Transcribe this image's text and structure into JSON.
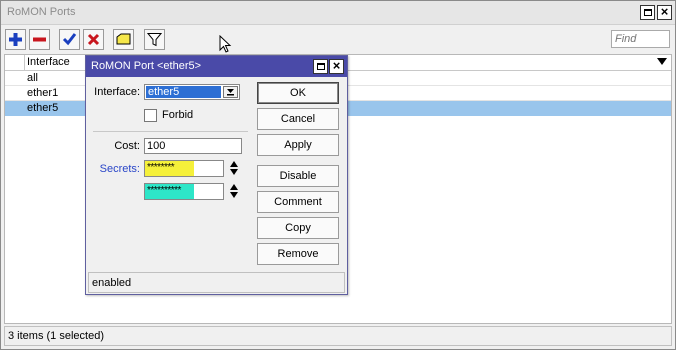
{
  "window": {
    "title": "RoMON Ports"
  },
  "toolbar": {
    "find_placeholder": "Find"
  },
  "table": {
    "column_header": "Interface",
    "rows": [
      {
        "interface": "all",
        "selected": false
      },
      {
        "interface": "ether1",
        "selected": false
      },
      {
        "interface": "ether5",
        "selected": true
      }
    ]
  },
  "status_bar": {
    "text": "3 items (1 selected)"
  },
  "dialog": {
    "title": "RoMON Port <ether5>",
    "interface_label": "Interface:",
    "interface_value": "ether5",
    "forbid_label": "Forbid",
    "forbid_checked": false,
    "cost_label": "Cost:",
    "cost_value": "100",
    "secrets_label": "Secrets:",
    "secret1_value": "********",
    "secret2_value": "**********",
    "buttons": {
      "ok": "OK",
      "cancel": "Cancel",
      "apply": "Apply",
      "disable": "Disable",
      "comment": "Comment",
      "copy": "Copy",
      "remove": "Remove"
    },
    "status": "enabled"
  },
  "colors": {
    "dialog_title_bg": "#4a4aa8",
    "selection_bg": "#99c5ec",
    "secret1_fill": "#f5f03a",
    "secret2_fill": "#2ee6c8",
    "secrets_label": "#2a46c8"
  }
}
